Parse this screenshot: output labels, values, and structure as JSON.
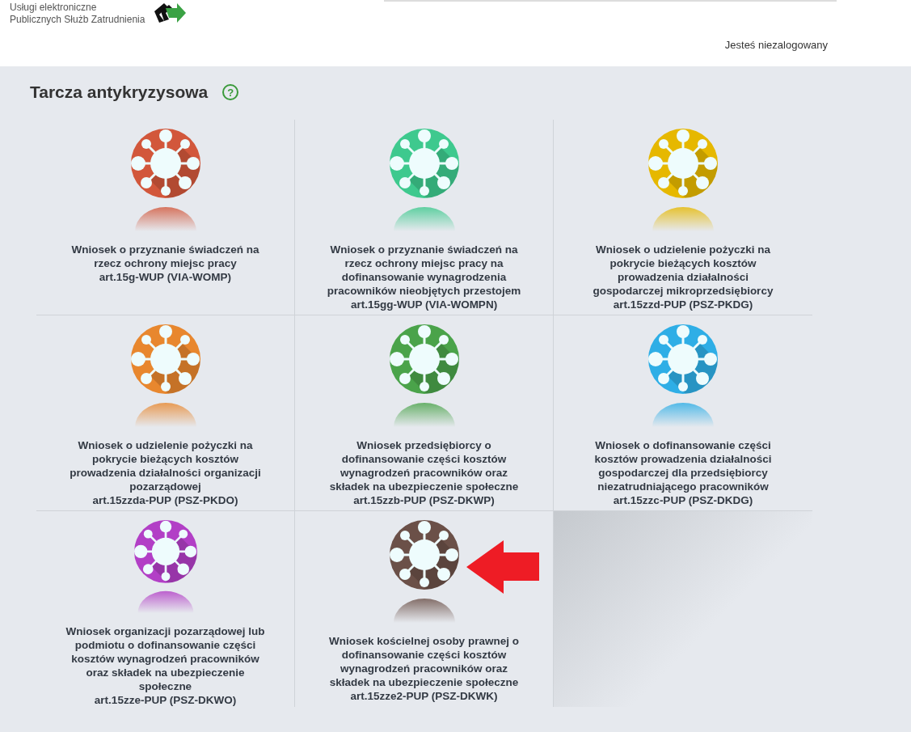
{
  "header": {
    "brand_lines": [
      "Usługi elektroniczne",
      "Publicznych Służb Zatrudnienia"
    ],
    "login_status": "Jesteś niezalogowany"
  },
  "page": {
    "title": "Tarcza antykryzysowa",
    "help": "?"
  },
  "cards": [
    {
      "title": "Wniosek o przyznanie świadczeń na rzecz ochrony miejsc pracy",
      "code": "art.15g-WUP (VIA-WOMP)",
      "color": "#d2573b",
      "marked": false
    },
    {
      "title": "Wniosek o przyznanie świadczeń na rzecz ochrony miejsc pracy na dofinansowanie wynagrodzenia pracowników nieobjętych przestojem",
      "code": "art.15gg-WUP (VIA-WOMPN)",
      "color": "#3ec98e",
      "marked": false
    },
    {
      "title": "Wniosek o udzielenie pożyczki na pokrycie bieżących kosztów prowadzenia działalności gospodarczej mikroprzedsiębiorcy",
      "code": "art.15zzd-PUP (PSZ-PKDG)",
      "color": "#e6b800",
      "marked": false
    },
    {
      "title": "Wniosek o udzielenie pożyczki na pokrycie bieżących kosztów prowadzenia działalności organizacji pozarządowej",
      "code": "art.15zzda-PUP (PSZ-PKDO)",
      "color": "#e8872e",
      "marked": false
    },
    {
      "title": "Wniosek przedsiębiorcy o dofinansowanie części kosztów wynagrodzeń pracowników oraz składek na ubezpieczenie społeczne",
      "code": "art.15zzb-PUP (PSZ-DKWP)",
      "color": "#4aa34a",
      "marked": false
    },
    {
      "title": "Wniosek o dofinansowanie części kosztów prowadzenia działalności gospodarczej dla przedsiębiorcy niezatrudniającego pracowników",
      "code": "art.15zzc-PUP (PSZ-DKDG)",
      "color": "#2eaee6",
      "marked": false
    },
    {
      "title": "Wniosek organizacji pozarządowej lub podmiotu o dofinansowanie części kosztów wynagrodzeń pracowników oraz składek na ubezpieczenie społeczne",
      "code": "art.15zze-PUP (PSZ-DKWO)",
      "color": "#b23fc6",
      "marked": false
    },
    {
      "title": "Wniosek kościelnej osoby prawnej o dofinansowanie części kosztów wynagrodzeń pracowników oraz składek na ubezpieczenie społeczne",
      "code": "art.15zze2-PUP (PSZ-DKWK)",
      "color": "#6b5048",
      "marked": true
    }
  ]
}
